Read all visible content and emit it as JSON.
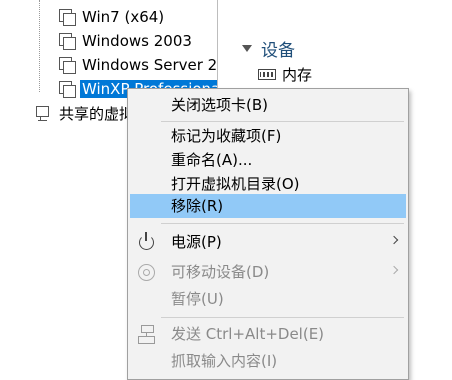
{
  "tree": {
    "items": [
      {
        "label": "Win7 (x64)"
      },
      {
        "label": "Windows 2003"
      },
      {
        "label": "Windows Server 2"
      },
      {
        "label": "WinXP Professional"
      }
    ],
    "shared_label": "共享的虚拟机"
  },
  "details": {
    "devices_title": "设备",
    "memory_label": "内存"
  },
  "menu": {
    "close_tab": "关闭选项卡(B)",
    "favorite": "标记为收藏项(F)",
    "rename": "重命名(A)...",
    "open_dir": "打开虚拟机目录(O)",
    "remove": "移除(R)",
    "power": "电源(P)",
    "removable": "可移动设备(D)",
    "pause": "暂停(U)",
    "send_cad": "发送 Ctrl+Alt+Del(E)",
    "grab_input": "抓取输入内容(I)"
  },
  "icons": {
    "vm": "vm-icon",
    "shared": "shared-vm-icon",
    "memory": "memory-icon",
    "power": "power-icon",
    "removable": "removable-device-icon",
    "cad": "send-cad-icon"
  },
  "colors": {
    "selection": "#0078d7",
    "menu_hover": "#91c9f7",
    "menu_bg": "#f2f2f2",
    "disabled_text": "#8a8a8a",
    "section_title": "#1f4e79"
  }
}
